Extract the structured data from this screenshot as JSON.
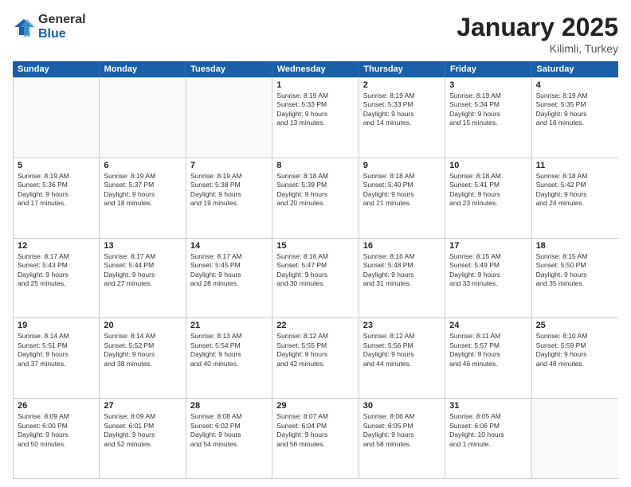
{
  "logo": {
    "general": "General",
    "blue": "Blue"
  },
  "header": {
    "month": "January 2025",
    "location": "Kilimli, Turkey"
  },
  "weekdays": [
    "Sunday",
    "Monday",
    "Tuesday",
    "Wednesday",
    "Thursday",
    "Friday",
    "Saturday"
  ],
  "weeks": [
    [
      {
        "date": "",
        "info": ""
      },
      {
        "date": "",
        "info": ""
      },
      {
        "date": "",
        "info": ""
      },
      {
        "date": "1",
        "info": "Sunrise: 8:19 AM\nSunset: 5:33 PM\nDaylight: 9 hours\nand 13 minutes."
      },
      {
        "date": "2",
        "info": "Sunrise: 8:19 AM\nSunset: 5:33 PM\nDaylight: 9 hours\nand 14 minutes."
      },
      {
        "date": "3",
        "info": "Sunrise: 8:19 AM\nSunset: 5:34 PM\nDaylight: 9 hours\nand 15 minutes."
      },
      {
        "date": "4",
        "info": "Sunrise: 8:19 AM\nSunset: 5:35 PM\nDaylight: 9 hours\nand 16 minutes."
      }
    ],
    [
      {
        "date": "5",
        "info": "Sunrise: 8:19 AM\nSunset: 5:36 PM\nDaylight: 9 hours\nand 17 minutes."
      },
      {
        "date": "6",
        "info": "Sunrise: 8:19 AM\nSunset: 5:37 PM\nDaylight: 9 hours\nand 18 minutes."
      },
      {
        "date": "7",
        "info": "Sunrise: 8:19 AM\nSunset: 5:38 PM\nDaylight: 9 hours\nand 19 minutes."
      },
      {
        "date": "8",
        "info": "Sunrise: 8:18 AM\nSunset: 5:39 PM\nDaylight: 9 hours\nand 20 minutes."
      },
      {
        "date": "9",
        "info": "Sunrise: 8:18 AM\nSunset: 5:40 PM\nDaylight: 9 hours\nand 21 minutes."
      },
      {
        "date": "10",
        "info": "Sunrise: 8:18 AM\nSunset: 5:41 PM\nDaylight: 9 hours\nand 23 minutes."
      },
      {
        "date": "11",
        "info": "Sunrise: 8:18 AM\nSunset: 5:42 PM\nDaylight: 9 hours\nand 24 minutes."
      }
    ],
    [
      {
        "date": "12",
        "info": "Sunrise: 8:17 AM\nSunset: 5:43 PM\nDaylight: 9 hours\nand 25 minutes."
      },
      {
        "date": "13",
        "info": "Sunrise: 8:17 AM\nSunset: 5:44 PM\nDaylight: 9 hours\nand 27 minutes."
      },
      {
        "date": "14",
        "info": "Sunrise: 8:17 AM\nSunset: 5:45 PM\nDaylight: 9 hours\nand 28 minutes."
      },
      {
        "date": "15",
        "info": "Sunrise: 8:16 AM\nSunset: 5:47 PM\nDaylight: 9 hours\nand 30 minutes."
      },
      {
        "date": "16",
        "info": "Sunrise: 8:16 AM\nSunset: 5:48 PM\nDaylight: 9 hours\nand 31 minutes."
      },
      {
        "date": "17",
        "info": "Sunrise: 8:15 AM\nSunset: 5:49 PM\nDaylight: 9 hours\nand 33 minutes."
      },
      {
        "date": "18",
        "info": "Sunrise: 8:15 AM\nSunset: 5:50 PM\nDaylight: 9 hours\nand 35 minutes."
      }
    ],
    [
      {
        "date": "19",
        "info": "Sunrise: 8:14 AM\nSunset: 5:51 PM\nDaylight: 9 hours\nand 37 minutes."
      },
      {
        "date": "20",
        "info": "Sunrise: 8:14 AM\nSunset: 5:52 PM\nDaylight: 9 hours\nand 38 minutes."
      },
      {
        "date": "21",
        "info": "Sunrise: 8:13 AM\nSunset: 5:54 PM\nDaylight: 9 hours\nand 40 minutes."
      },
      {
        "date": "22",
        "info": "Sunrise: 8:12 AM\nSunset: 5:55 PM\nDaylight: 9 hours\nand 42 minutes."
      },
      {
        "date": "23",
        "info": "Sunrise: 8:12 AM\nSunset: 5:56 PM\nDaylight: 9 hours\nand 44 minutes."
      },
      {
        "date": "24",
        "info": "Sunrise: 8:11 AM\nSunset: 5:57 PM\nDaylight: 9 hours\nand 46 minutes."
      },
      {
        "date": "25",
        "info": "Sunrise: 8:10 AM\nSunset: 5:59 PM\nDaylight: 9 hours\nand 48 minutes."
      }
    ],
    [
      {
        "date": "26",
        "info": "Sunrise: 8:09 AM\nSunset: 6:00 PM\nDaylight: 9 hours\nand 50 minutes."
      },
      {
        "date": "27",
        "info": "Sunrise: 8:09 AM\nSunset: 6:01 PM\nDaylight: 9 hours\nand 52 minutes."
      },
      {
        "date": "28",
        "info": "Sunrise: 8:08 AM\nSunset: 6:02 PM\nDaylight: 9 hours\nand 54 minutes."
      },
      {
        "date": "29",
        "info": "Sunrise: 8:07 AM\nSunset: 6:04 PM\nDaylight: 9 hours\nand 56 minutes."
      },
      {
        "date": "30",
        "info": "Sunrise: 8:06 AM\nSunset: 6:05 PM\nDaylight: 9 hours\nand 58 minutes."
      },
      {
        "date": "31",
        "info": "Sunrise: 8:05 AM\nSunset: 6:06 PM\nDaylight: 10 hours\nand 1 minute."
      },
      {
        "date": "",
        "info": ""
      }
    ]
  ]
}
